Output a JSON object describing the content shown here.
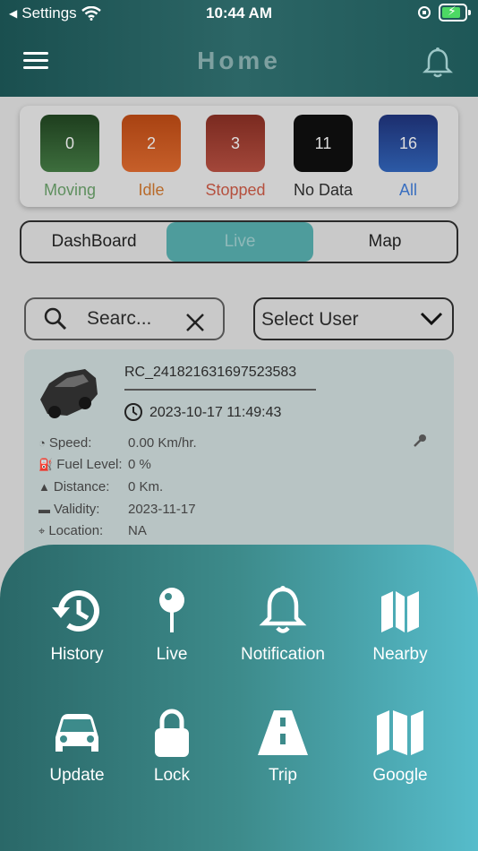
{
  "status_bar": {
    "back_label": "Settings",
    "time": "10:44 AM"
  },
  "header": {
    "title": "Home"
  },
  "summary": [
    {
      "count": "0",
      "label": "Moving",
      "bg": "#2e5a2e",
      "label_color": "#5e8f5e"
    },
    {
      "count": "2",
      "label": "Idle",
      "bg": "#b8501d",
      "label_color": "#b86a2a"
    },
    {
      "count": "3",
      "label": "Stopped",
      "bg": "#8e3b2d",
      "label_color": "#b5503e"
    },
    {
      "count": "11",
      "label": "No Data",
      "bg": "#111111",
      "label_color": "#2a2a2a"
    },
    {
      "count": "16",
      "label": "All",
      "bg": "#1f3a7a",
      "label_color": "#3a6fc0"
    }
  ],
  "tabs": {
    "dashboard": "DashBoard",
    "live": "Live",
    "map": "Map"
  },
  "search": {
    "value": "Searc..."
  },
  "select": {
    "value": "Select User"
  },
  "vehicle": {
    "id": "RC_241821631697523583",
    "timestamp": "2023-10-17 11:49:43",
    "speed_label": "Speed:",
    "speed_value": "0.00 Km/hr.",
    "fuel_label": "Fuel Level:",
    "fuel_value": "0 %",
    "distance_label": "Distance:",
    "distance_value": "0 Km.",
    "validity_label": "Validity:",
    "validity_value": "2023-11-17",
    "location_label": "Location:",
    "location_value": "NA"
  },
  "actions": {
    "history": "History",
    "live": "Live",
    "notification": "Notification",
    "nearby": "Nearby",
    "update": "Update",
    "lock": "Lock",
    "trip": "Trip",
    "google": "Google"
  }
}
